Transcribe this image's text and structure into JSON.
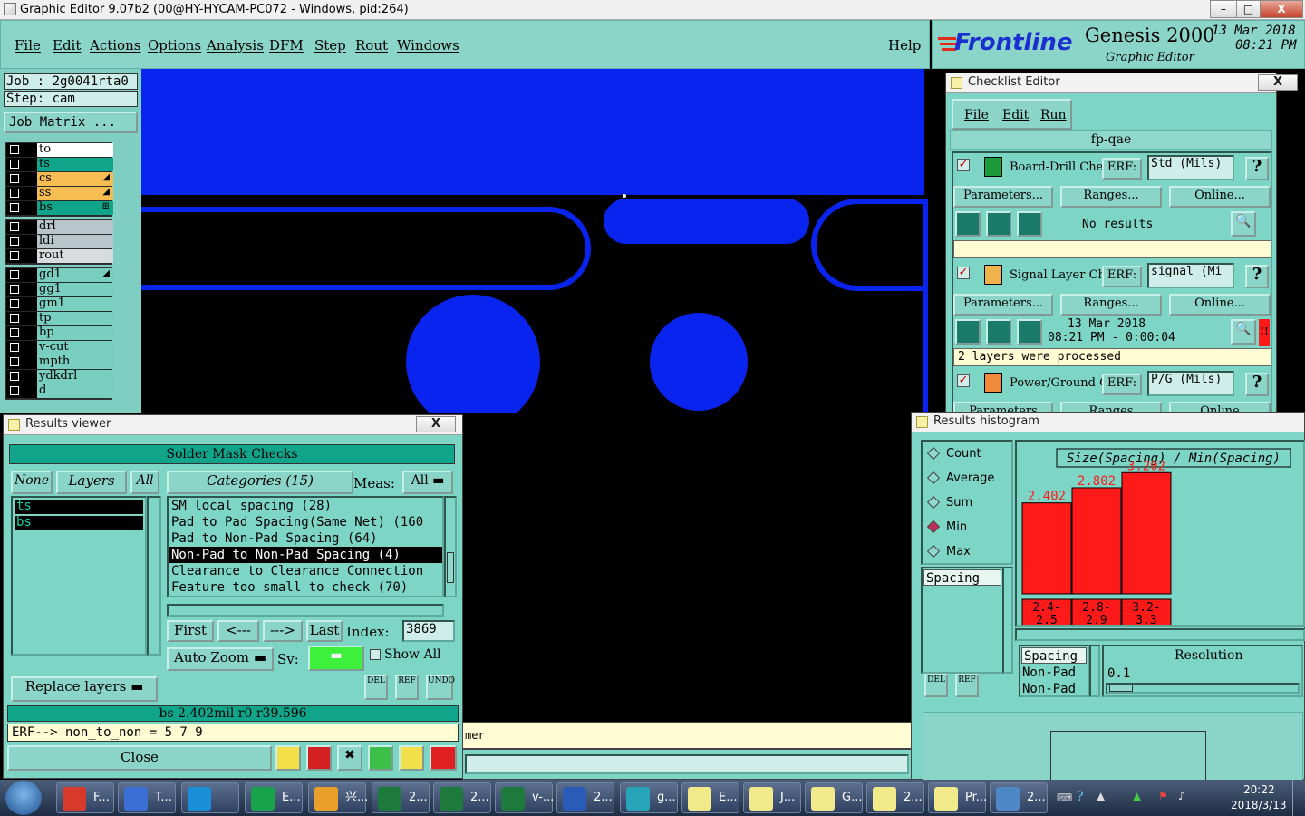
{
  "window": {
    "title": "Graphic Editor 9.07b2 (00@HY-HYCAM-PC072 - Windows, pid:264)",
    "min": "–",
    "max": "□",
    "close": "X"
  },
  "menu": [
    "File",
    "Edit",
    "Actions",
    "Options",
    "Analysis",
    "DFM",
    "Step",
    "Rout",
    "Windows"
  ],
  "help": "Help",
  "brand": {
    "logo": "Frontline",
    "product": "Genesis 2000",
    "subtitle": "Graphic Editor",
    "date": "13 Mar 2018",
    "time": "08:21 PM"
  },
  "job": {
    "job_line": "Job : 2g0041rta0",
    "step_line": "Step: cam",
    "matrix_button": "Job Matrix ..."
  },
  "layers_group1": [
    {
      "name": "to",
      "color": "#ffffff",
      "mark": ""
    },
    {
      "name": "ts",
      "color": "#10a58a",
      "mark": ""
    },
    {
      "name": "cs",
      "color": "#f5bd52",
      "mark": "◢"
    },
    {
      "name": "ss",
      "color": "#f5bd52",
      "mark": "◢"
    },
    {
      "name": "bs",
      "color": "#10a58a",
      "mark": "⊞"
    }
  ],
  "layers_group2": [
    {
      "name": "drl",
      "color": "#b8c6cc",
      "mark": ""
    },
    {
      "name": "ldi",
      "color": "#b8c6cc",
      "mark": ""
    },
    {
      "name": "rout",
      "color": "#d9dcdc",
      "mark": ""
    }
  ],
  "layers_group3": [
    {
      "name": "gd1",
      "color": "#78cfc0",
      "mark": "◢"
    },
    {
      "name": "gg1",
      "color": "#78cfc0",
      "mark": ""
    },
    {
      "name": "gm1",
      "color": "#78cfc0",
      "mark": ""
    },
    {
      "name": "tp",
      "color": "#78cfc0",
      "mark": ""
    },
    {
      "name": "bp",
      "color": "#78cfc0",
      "mark": ""
    },
    {
      "name": "v-cut",
      "color": "#78cfc0",
      "mark": ""
    },
    {
      "name": "mpth",
      "color": "#78cfc0",
      "mark": ""
    },
    {
      "name": "ydkdrl",
      "color": "#78cfc0",
      "mark": ""
    },
    {
      "name": "d",
      "color": "#78cfc0",
      "mark": ""
    }
  ],
  "checklist": {
    "title": "Checklist Editor",
    "menu": [
      "File",
      "Edit",
      "Run"
    ],
    "name": "fp-qae",
    "items": [
      {
        "name": "Board-Drill Che",
        "erf_label": "ERF:",
        "erf_value": "Std (Mils)",
        "params": "Parameters...",
        "ranges": "Ranges...",
        "online": "Online...",
        "status": "No results",
        "date": "",
        "time": "",
        "message": ""
      },
      {
        "name": "Signal Layer Ch",
        "erf_label": "ERF:",
        "erf_value": "signal (Mi",
        "params": "Parameters...",
        "ranges": "Ranges...",
        "online": "Online...",
        "status": "",
        "date": "13 Mar 2018",
        "time": "08:21 PM - 0:00:04",
        "message": "2 layers were processed"
      },
      {
        "name": "Power/Ground C",
        "erf_label": "ERF:",
        "erf_value": "P/G (Mils)",
        "params": "Parameters",
        "ranges": "Ranges",
        "online": "Online",
        "status": "",
        "date": "",
        "time": "",
        "message": ""
      }
    ],
    "help": "?",
    "alert": "!!"
  },
  "results_viewer": {
    "title": "Results viewer",
    "header": "Solder Mask Checks",
    "none_btn": "None",
    "layers_btn": "Layers",
    "all_btn": "All",
    "categories_btn": "Categories (15)",
    "meas_label": "Meas:",
    "meas_value": "All",
    "layers": [
      "ts",
      "bs"
    ],
    "categories": [
      "SM local spacing (28)",
      "Pad to Pad Spacing(Same Net) (160",
      "Pad to Non-Pad Spacing (64)",
      "Non-Pad to Non-Pad Spacing (4)",
      "Clearance to Clearance Connection",
      "Feature too small to check (70)"
    ],
    "selected_category": 3,
    "first": "First",
    "prev": "<---",
    "next": "--->",
    "last": "Last",
    "index_label": "Index:",
    "index_value": "3869",
    "auto_zoom": "Auto Zoom",
    "sv_label": "Sv:",
    "show_all": "Show All",
    "replace_layers": "Replace layers",
    "del": "DEL",
    "ref": "REF",
    "undo": "UNDO",
    "status": "bs 2.402mil  r0  r39.596",
    "erf_line": "ERF--> non_to_non = 5 7 9",
    "close": "Close"
  },
  "histogram": {
    "title": "Results histogram",
    "modes": [
      "Count",
      "Average",
      "Sum",
      "Min",
      "Max"
    ],
    "selected_mode": "Min",
    "list_left": [
      "Spacing"
    ],
    "chart_title": "Size(Spacing) / Min(Spacing)",
    "list_bottom": [
      "Spacing",
      "Non-Pad",
      "Non-Pad"
    ],
    "resolution_label": "Resolution",
    "resolution_value": "0.1",
    "del": "DEL",
    "ref": "REF",
    "chart_data": {
      "type": "bar",
      "title": "Size(Spacing) / Min(Spacing)",
      "categories": [
        "2.4-2.5",
        "2.8-2.9",
        "3.2-3.3"
      ],
      "category_lines": [
        [
          "2.4-",
          "2.5"
        ],
        [
          "2.8-",
          "2.9"
        ],
        [
          "3.2-",
          "3.3"
        ]
      ],
      "values": [
        2.402,
        2.802,
        3.202
      ],
      "value_labels": [
        "2.402",
        "2.802",
        "3.202"
      ],
      "ylim": [
        0,
        3.4
      ],
      "bar_color": "#ff1a1a",
      "grid": false,
      "xlabel": "",
      "ylabel": ""
    }
  },
  "canvas_status": "mer",
  "taskbar": {
    "items": [
      {
        "label": "F...",
        "color": "#d73a2a"
      },
      {
        "label": "T...",
        "color": "#3b6fd6"
      },
      {
        "label": "",
        "color": "#1a8fd8"
      },
      {
        "label": "E...",
        "color": "#1aa14b"
      },
      {
        "label": "兴...",
        "color": "#e8a02a"
      },
      {
        "label": "2...",
        "color": "#1e7a3c"
      },
      {
        "label": "2...",
        "color": "#1e7a3c"
      },
      {
        "label": "v-...",
        "color": "#1e7a3c"
      },
      {
        "label": "2...",
        "color": "#2a5bb8"
      },
      {
        "label": "g...",
        "color": "#29a3b8"
      },
      {
        "label": "E...",
        "color": "#f2ea8a"
      },
      {
        "label": "J...",
        "color": "#f2ea8a"
      },
      {
        "label": "G...",
        "color": "#f2ea8a"
      },
      {
        "label": "2...",
        "color": "#f2ea8a"
      },
      {
        "label": "Pr...",
        "color": "#f2ea8a"
      },
      {
        "label": "2...",
        "color": "#4f86c4"
      }
    ],
    "clock_time": "20:22",
    "clock_date": "2018/3/13"
  }
}
